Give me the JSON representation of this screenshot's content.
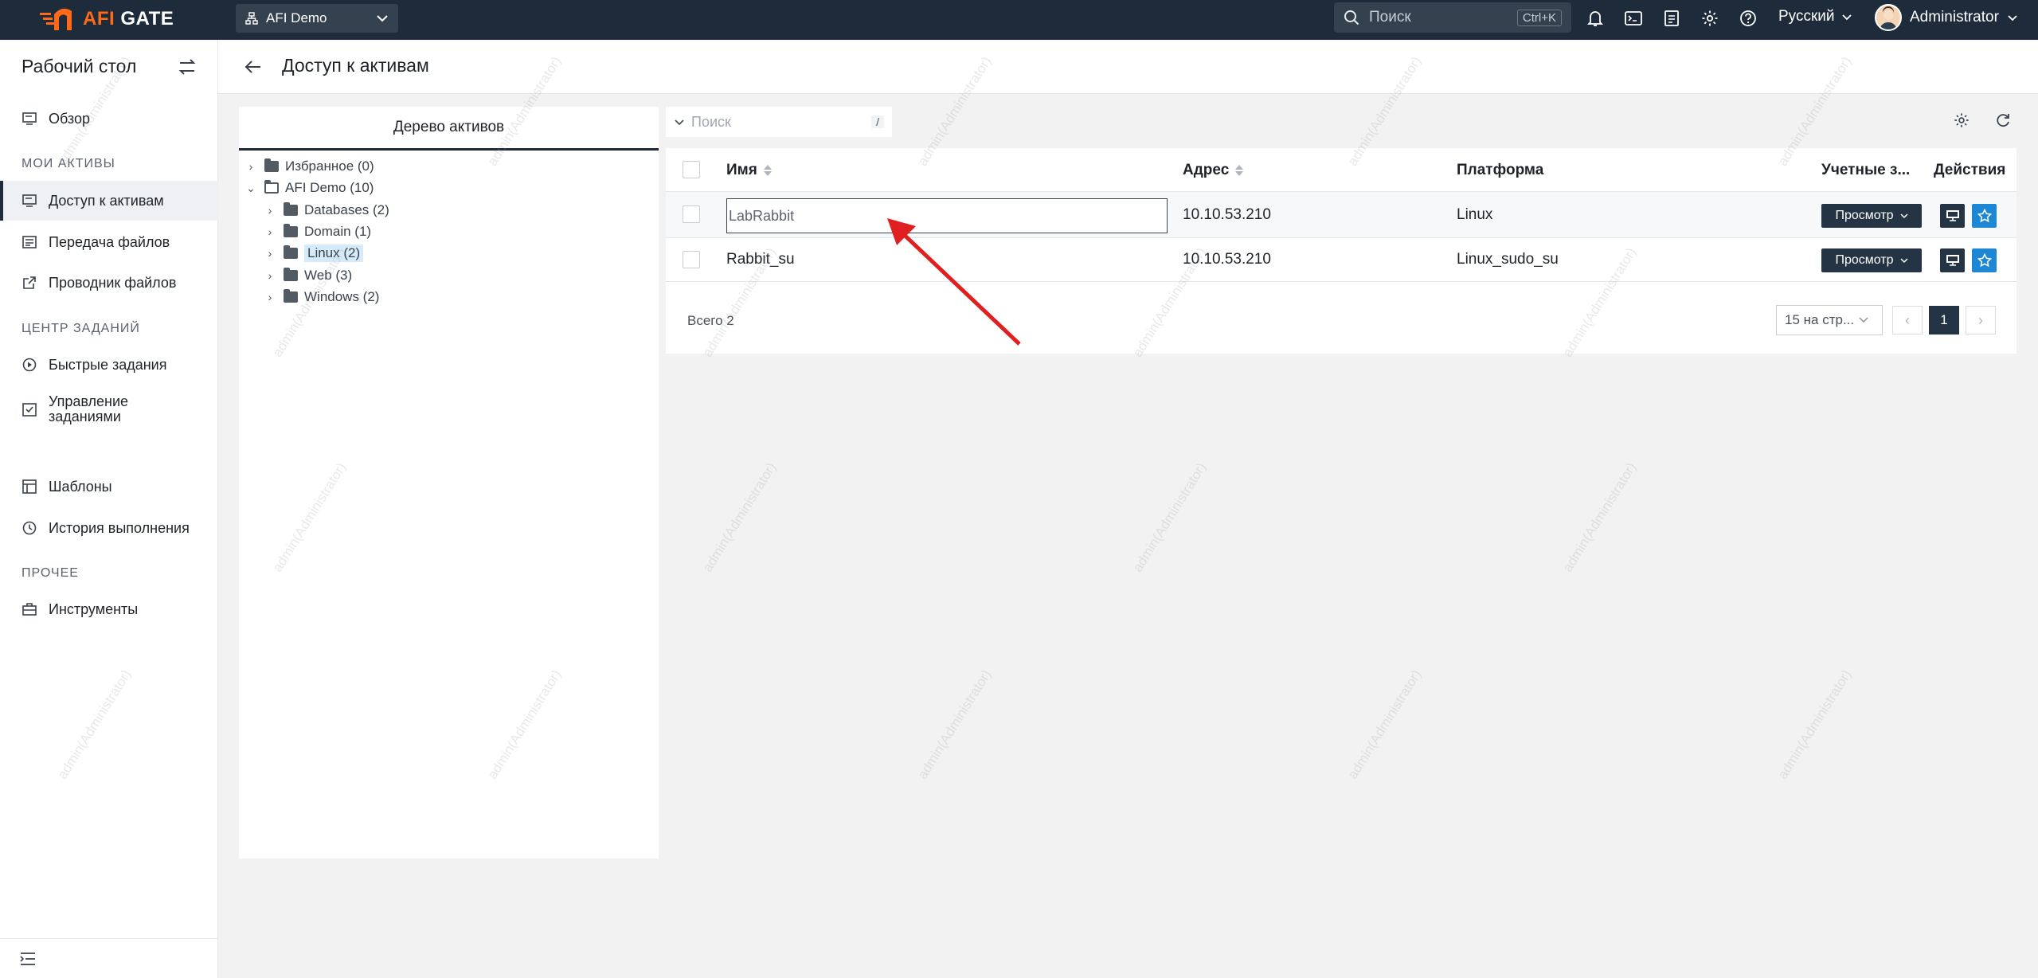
{
  "app": {
    "brand_afi": "AFI",
    "brand_gate": "GATE",
    "org": "AFI Demo",
    "search_placeholder": "Поиск",
    "search_shortcut": "Ctrl+K",
    "language": "Русский",
    "user": "Administrator"
  },
  "sidebar": {
    "title": "Рабочий стол",
    "items": [
      {
        "label": "Обзор",
        "icon": "monitor-icon"
      },
      {
        "label": "Доступ к активам",
        "icon": "terminal-icon"
      },
      {
        "label": "Передача файлов",
        "icon": "file-transfer-icon"
      },
      {
        "label": "Проводник файлов",
        "icon": "external-link-icon"
      },
      {
        "label": "Быстрые задания",
        "icon": "play-circle-icon"
      },
      {
        "label": "Управление заданиями",
        "icon": "checklist-icon"
      },
      {
        "label": "Шаблоны",
        "icon": "template-icon"
      },
      {
        "label": "История выполнения",
        "icon": "history-icon"
      },
      {
        "label": "Инструменты",
        "icon": "toolbox-icon"
      }
    ],
    "sections": {
      "my_assets": "МОИ АКТИВЫ",
      "task_center": "ЦЕНТР ЗАДАНИЙ",
      "other": "ПРОЧЕЕ"
    }
  },
  "header": {
    "title": "Доступ к активам"
  },
  "tree": {
    "tab": "Дерево активов",
    "nodes": [
      {
        "label": "Избранное (0)"
      },
      {
        "label": "AFI Demo (10)"
      },
      {
        "label": "Databases (2)"
      },
      {
        "label": "Domain (1)"
      },
      {
        "label": "Linux (2)"
      },
      {
        "label": "Web (3)"
      },
      {
        "label": "Windows (2)"
      }
    ]
  },
  "table": {
    "search_placeholder": "Поиск",
    "search_key": "/",
    "columns": {
      "name": "Имя",
      "address": "Адрес",
      "platform": "Платформа",
      "accounts": "Учетные з...",
      "actions": "Действия"
    },
    "rows": [
      {
        "name": "LabRabbit",
        "address": "10.10.53.210",
        "platform": "Linux",
        "accounts_btn": "Просмотр"
      },
      {
        "name": "Rabbit_su",
        "address": "10.10.53.210",
        "platform": "Linux_sudo_su",
        "accounts_btn": "Просмотр"
      }
    ],
    "total": "Всего 2",
    "page_size": "15 на стр...",
    "current_page": "1"
  },
  "watermark": "admin(Administrator)",
  "colors": {
    "topbar": "#1e2b3a",
    "brand_orange": "#ff6a1a",
    "dark_button": "#253444",
    "blue_button": "#1d87d6",
    "annotation": "#e02020"
  }
}
